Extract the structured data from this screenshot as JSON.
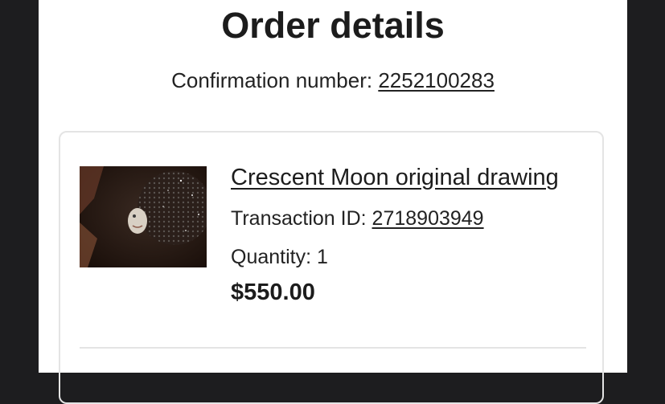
{
  "page": {
    "title": "Order details",
    "confirmation_label": "Confirmation number:",
    "confirmation_number": "2252100283"
  },
  "item": {
    "title": "Crescent Moon original drawing",
    "transaction_label": "Transaction ID:",
    "transaction_id": "2718903949",
    "quantity_label": "Quantity:",
    "quantity": "1",
    "price": "$550.00",
    "image_icon": "crescent-moon-artwork-image"
  },
  "colors": {
    "background": "#1d1d1f",
    "panel": "#ffffff",
    "text": "#222222",
    "border": "#e4e4e4"
  }
}
